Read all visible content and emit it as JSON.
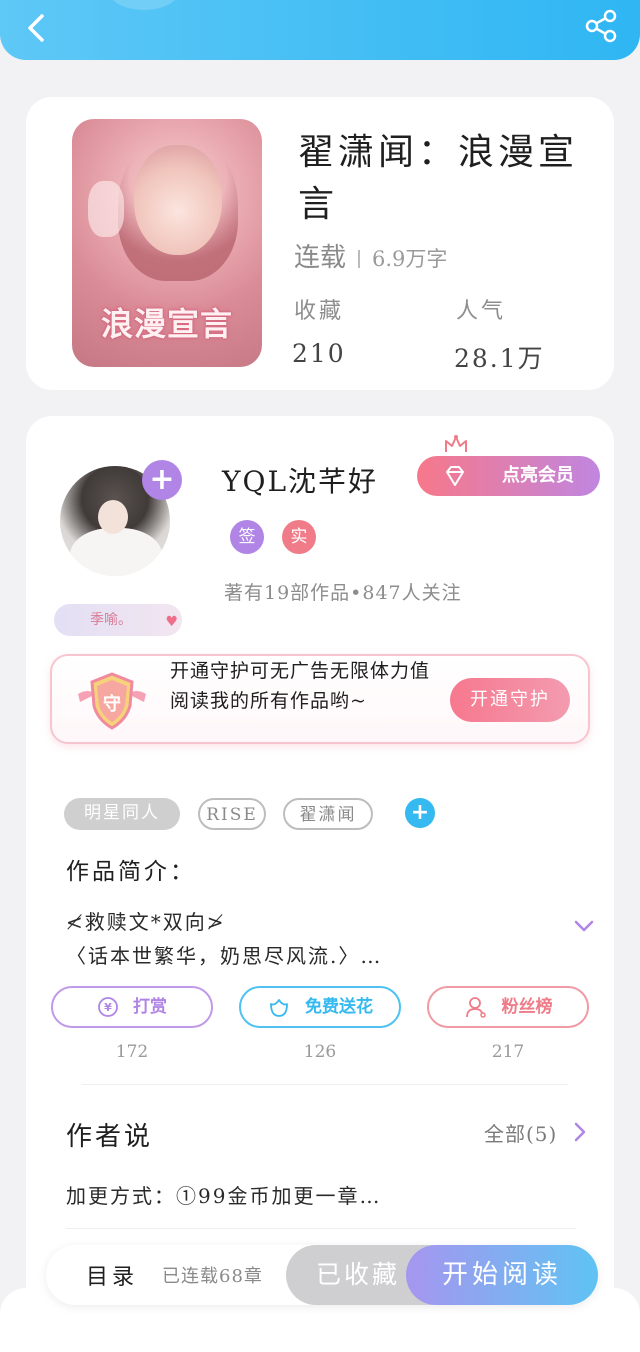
{
  "book": {
    "title": "翟潇闻：浪漫宣言",
    "cover_title": "浪漫宣言",
    "status": "连载",
    "word_count": "6.9万字",
    "favorites_label": "收藏",
    "favorites_value": "210",
    "popularity_label": "人气",
    "popularity_value": "28.1万"
  },
  "author": {
    "name": "YQL沈芊好",
    "badges": [
      "签",
      "实"
    ],
    "meta": "著有19部作品•847人关注",
    "sticker": "季喻。",
    "vip_button": "点亮会员"
  },
  "guard": {
    "badge_char": "守",
    "text": "开通守护可无广告无限体力值阅读我的所有作品哟~",
    "button": "开通守护"
  },
  "tags": [
    "明星同人",
    "RISE",
    "翟潇闻"
  ],
  "intro": {
    "title": "作品简介：",
    "line1": "≮救赎文*双向≯",
    "line2": "〈话本世繁华，奶思尽风流.〉…"
  },
  "actions": [
    {
      "label": "打赏",
      "count": "172"
    },
    {
      "label": "免费送花",
      "count": "126"
    },
    {
      "label": "粉丝榜",
      "count": "217"
    }
  ],
  "author_say": {
    "title": "作者说",
    "all_link": "全部(5)",
    "text": "加更方式：①99金币加更一章…"
  },
  "bottom": {
    "toc": "目录",
    "serial": "已连载68章",
    "collected": "已收藏",
    "read": "开始阅读"
  },
  "colors": {
    "top_bar": "#2fb6f3",
    "vip_gradient_start": "#f7788a",
    "vip_gradient_end": "#c086e0",
    "reward": "#b085e6",
    "flower": "#34b9f0",
    "fans": "#ef7c88"
  }
}
